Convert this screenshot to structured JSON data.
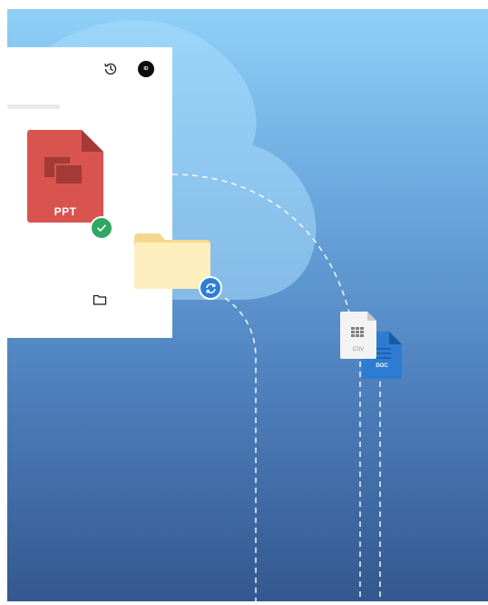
{
  "toolbar": {
    "folder_icon": "folder-icon",
    "history_icon": "history-icon",
    "avatar_initials": "ID"
  },
  "files": {
    "ppt": {
      "label": "PPT",
      "status": "synced"
    },
    "folder": {
      "status": "syncing"
    },
    "csv": {
      "label": "CSV"
    },
    "doc": {
      "label": "DOC"
    }
  },
  "colors": {
    "ppt": "#d9534f",
    "check": "#2fa863",
    "folder": "#fbe5a8",
    "sync": "#2e7ed6",
    "doc": "#2d7cd2",
    "csv": "#f3f3f3"
  }
}
